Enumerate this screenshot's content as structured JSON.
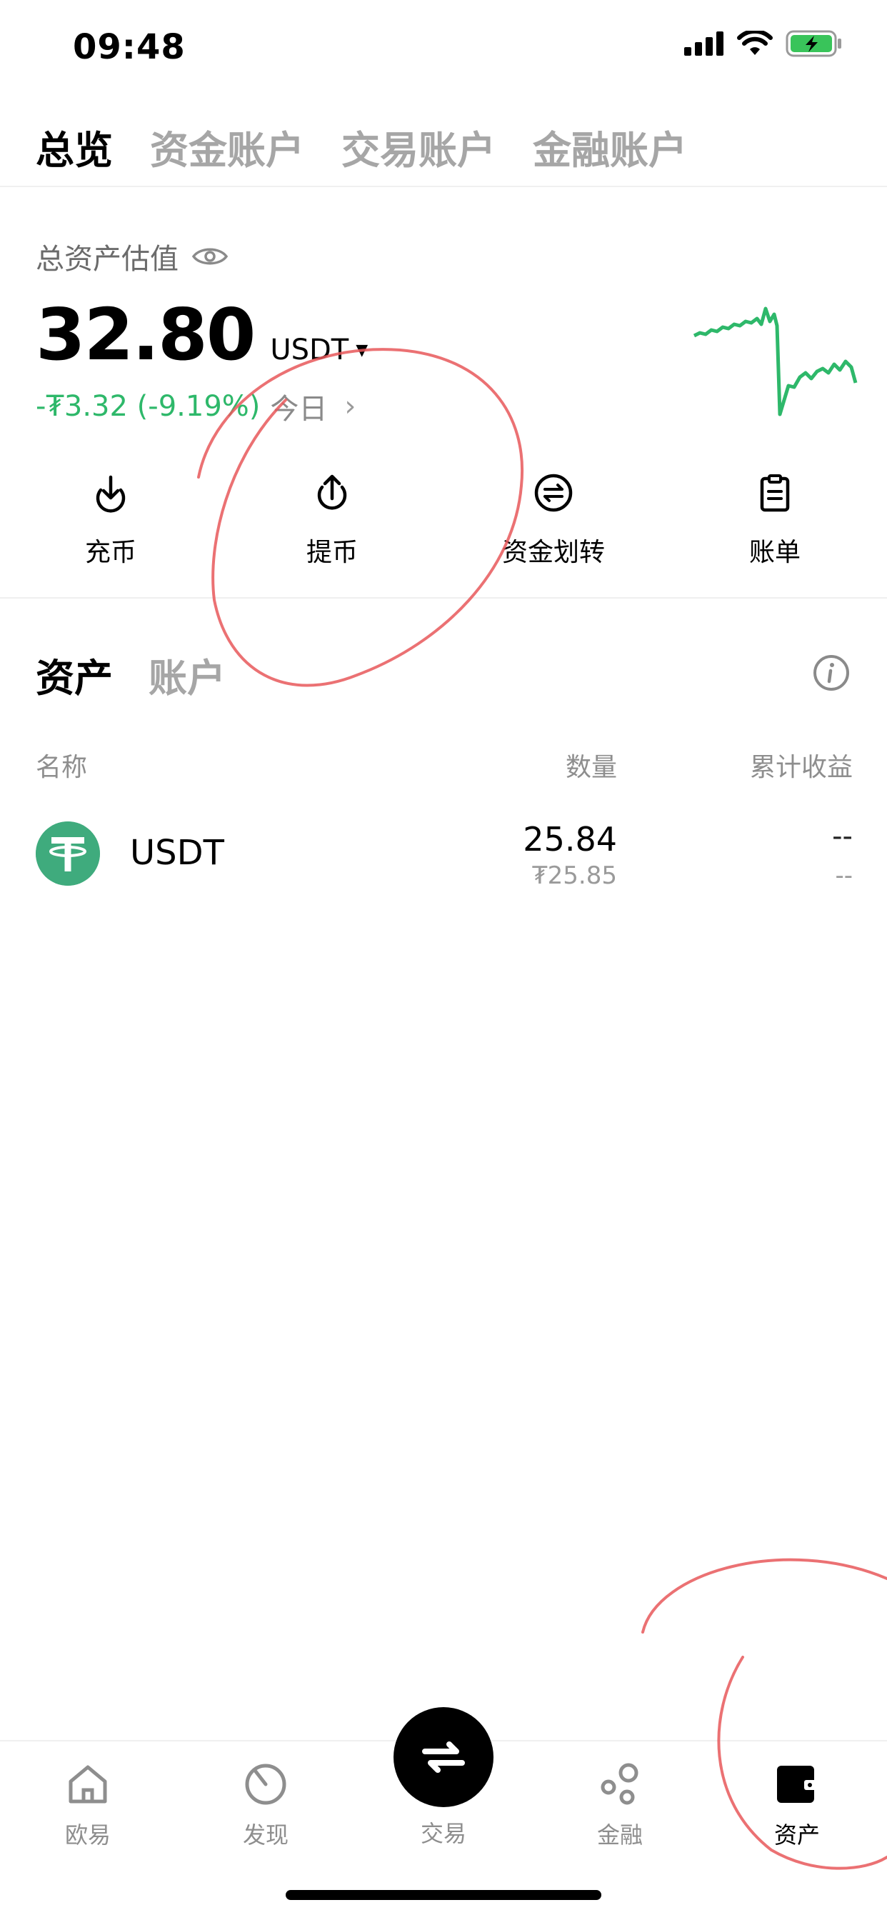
{
  "status_bar": {
    "time": "09:48"
  },
  "top_tabs": [
    {
      "label": "总览",
      "active": true
    },
    {
      "label": "资金账户",
      "active": false
    },
    {
      "label": "交易账户",
      "active": false
    },
    {
      "label": "金融账户",
      "active": false
    }
  ],
  "overview": {
    "label": "总资产估值",
    "balance": "32.80",
    "unit": "USDT",
    "change": "-₮3.32 (-9.19%)",
    "period": "今日"
  },
  "actions": [
    {
      "label": "充币",
      "icon": "deposit-icon"
    },
    {
      "label": "提币",
      "icon": "withdraw-icon"
    },
    {
      "label": "资金划转",
      "icon": "transfer-icon"
    },
    {
      "label": "账单",
      "icon": "bill-icon"
    }
  ],
  "section_tabs": [
    {
      "label": "资产",
      "active": true
    },
    {
      "label": "账户",
      "active": false
    }
  ],
  "columns": {
    "name": "名称",
    "quantity": "数量",
    "profit": "累计收益"
  },
  "assets": [
    {
      "name": "USDT",
      "quantity": "25.84",
      "value": "₮25.85",
      "profit": "--",
      "profit_sub": "--"
    }
  ],
  "bottom_nav": [
    {
      "label": "欧易",
      "icon": "home-icon",
      "active": false
    },
    {
      "label": "发现",
      "icon": "discover-icon",
      "active": false
    },
    {
      "label": "交易",
      "icon": "swap-icon",
      "active": false
    },
    {
      "label": "金融",
      "icon": "finance-icon",
      "active": false
    },
    {
      "label": "资产",
      "icon": "wallet-icon",
      "active": true
    }
  ],
  "colors": {
    "positive": "#2eb86a",
    "muted": "#a6a6a6",
    "usdt": "#3fab7d",
    "annotation": "#e8585a"
  }
}
